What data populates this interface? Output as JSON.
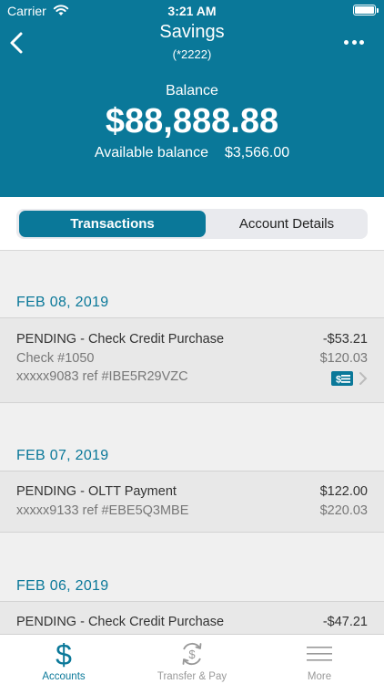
{
  "status_bar": {
    "carrier": "Carrier",
    "time": "3:21 AM"
  },
  "nav": {
    "title": "Savings",
    "subtitle": "(*2222)"
  },
  "balance": {
    "label": "Balance",
    "amount": "$88,888.88",
    "available_label": "Available balance",
    "available_amount": "$3,566.00"
  },
  "tabs": {
    "transactions": "Transactions",
    "account_details": "Account Details"
  },
  "groups": [
    {
      "date": "FEB 08, 2019",
      "transactions": [
        {
          "description": "PENDING - Check Credit Purchase",
          "line2": "Check #1050",
          "line3": "xxxxx9083 ref #IBE5R29VZC",
          "amount": "-$53.21",
          "balance": "$120.03",
          "icon": "check-image-icon"
        }
      ]
    },
    {
      "date": "FEB 07, 2019",
      "transactions": [
        {
          "description": "PENDING - OLTT Payment",
          "line2": "xxxxx9133 ref #EBE5Q3MBE",
          "amount": "$122.00",
          "balance": "$220.03"
        }
      ]
    },
    {
      "date": "FEB 06, 2019",
      "transactions": [
        {
          "description": "PENDING - Check Credit Purchase",
          "amount": "-$47.21"
        }
      ]
    }
  ],
  "tab_bar": [
    {
      "label": "Accounts",
      "icon": "dollar-icon",
      "active": true
    },
    {
      "label": "Transfer & Pay",
      "icon": "transfer-icon",
      "active": false
    },
    {
      "label": "More",
      "icon": "menu-icon",
      "active": false
    }
  ],
  "colors": {
    "brand": "#0a7899",
    "row_bg": "#e8e8e8"
  }
}
